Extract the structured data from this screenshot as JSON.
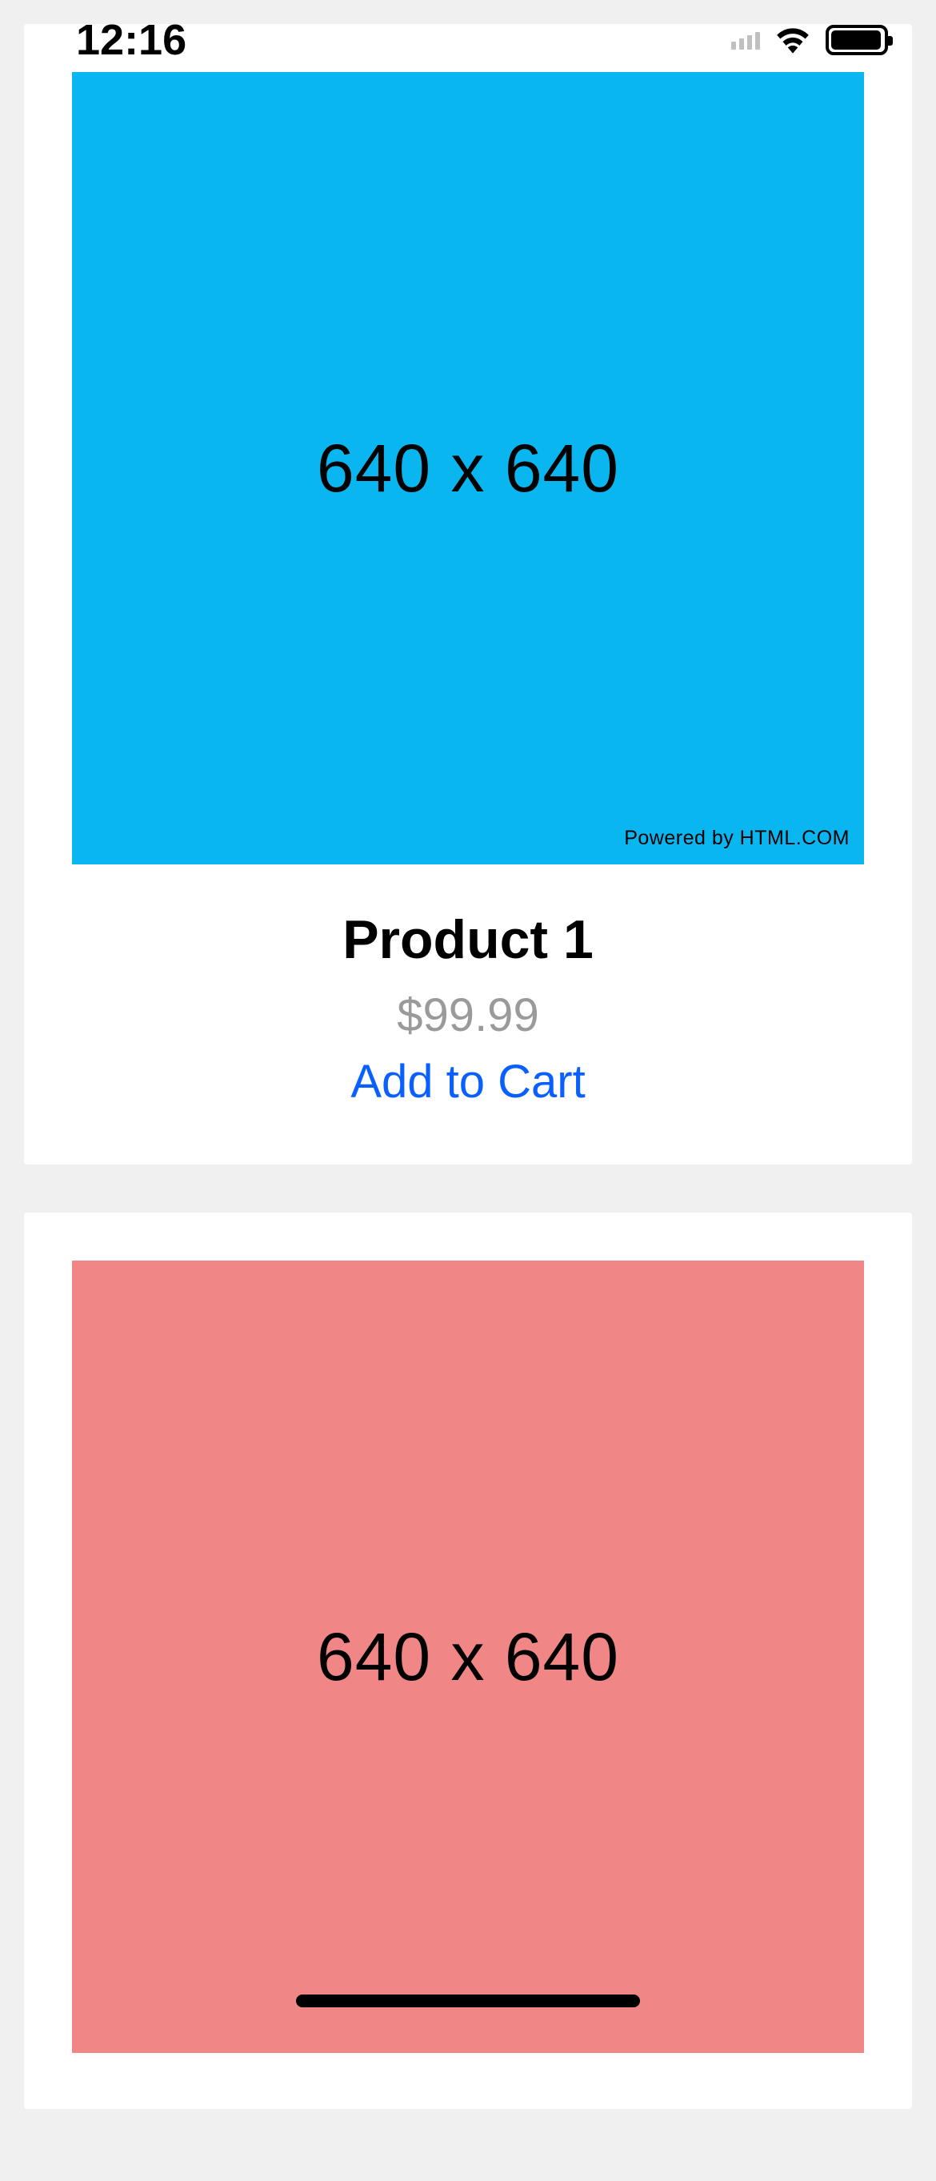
{
  "statusBar": {
    "time": "12:16"
  },
  "products": [
    {
      "imageText": "640 x 640",
      "watermark": "Powered by HTML.COM",
      "title": "Product 1",
      "price": "$99.99",
      "addToCartLabel": "Add to Cart",
      "imageBgColor": "#0ab6f0"
    },
    {
      "imageText": "640 x 640",
      "imageBgColor": "#f08686"
    }
  ]
}
